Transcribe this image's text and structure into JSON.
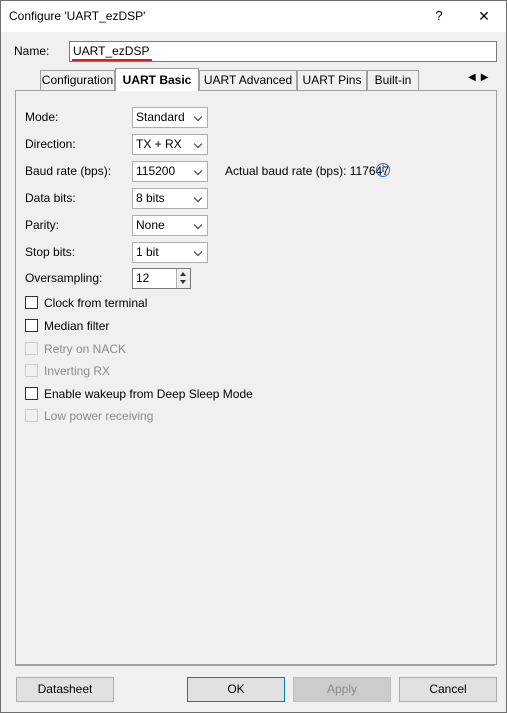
{
  "window": {
    "title": "Configure 'UART_ezDSP'",
    "help_glyph": "?",
    "close_glyph": "✕"
  },
  "name": {
    "label": "Name:",
    "value": "UART_ezDSP"
  },
  "tabs": [
    {
      "label": "Configuration"
    },
    {
      "label": "UART Basic",
      "active": true
    },
    {
      "label": "UART Advanced"
    },
    {
      "label": "UART Pins"
    },
    {
      "label": "Built-in"
    }
  ],
  "tab_scroll": {
    "left": "◀",
    "right": "▶"
  },
  "fields": {
    "mode": {
      "label": "Mode:",
      "value": "Standard"
    },
    "direction": {
      "label": "Direction:",
      "value": "TX + RX"
    },
    "baud": {
      "label": "Baud rate (bps):",
      "value": "115200",
      "actual": "Actual baud rate (bps): 117647",
      "info_icon": "i"
    },
    "data_bits": {
      "label": "Data bits:",
      "value": "8 bits"
    },
    "parity": {
      "label": "Parity:",
      "value": "None"
    },
    "stop_bits": {
      "label": "Stop bits:",
      "value": "1 bit"
    },
    "oversampling": {
      "label": "Oversampling:",
      "value": "12"
    }
  },
  "checkboxes": [
    {
      "label": "Clock from terminal",
      "checked": false,
      "enabled": true
    },
    {
      "label": "Median filter",
      "checked": false,
      "enabled": true
    },
    {
      "label": "Retry on NACK",
      "checked": false,
      "enabled": false
    },
    {
      "label": "Inverting RX",
      "checked": false,
      "enabled": false
    },
    {
      "label": "Enable wakeup from Deep Sleep Mode",
      "checked": false,
      "enabled": true
    },
    {
      "label": "Low power receiving",
      "checked": false,
      "enabled": false
    }
  ],
  "buttons": {
    "datasheet": "Datasheet",
    "ok": "OK",
    "apply": "Apply",
    "cancel": "Cancel"
  },
  "colors": {
    "name_underline": "#d91e1e",
    "info_icon": "#2c6fc4",
    "ok_border": "#0078d7"
  }
}
